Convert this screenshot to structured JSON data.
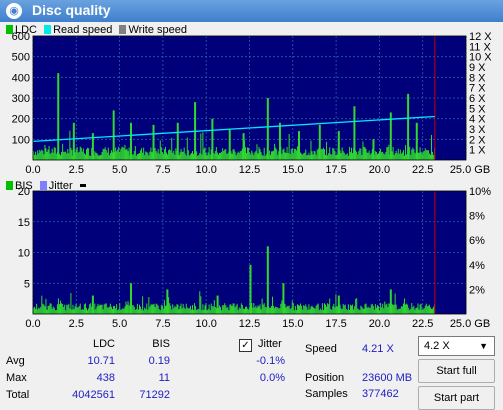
{
  "window": {
    "title": "Disc quality",
    "logo": "disc-logo-icon"
  },
  "top_legend": [
    {
      "label": "LDC",
      "color": "#00c000"
    },
    {
      "label": "Read speed",
      "color": "#00e8e8"
    },
    {
      "label": "Write speed",
      "color": "#808080"
    }
  ],
  "bottom_legend": [
    {
      "label": "BIS",
      "color": "#00c000"
    },
    {
      "label": "Jitter",
      "color": "#8080ff"
    }
  ],
  "colors": {
    "plot_bg": "#00007a",
    "grid": "#2a5fa8",
    "bar": "#30d830",
    "speed": "#00e8ff",
    "marker": "#c00000"
  },
  "chart_data": [
    {
      "type": "bar",
      "name": "LDC chart",
      "x_ticks": [
        "0.0",
        "2.5",
        "5.0",
        "7.5",
        "10.0",
        "12.5",
        "15.0",
        "17.5",
        "20.0",
        "22.5",
        "25.0 GB"
      ],
      "y_ticks_left": [
        "100",
        "200",
        "300",
        "400",
        "500",
        "600"
      ],
      "y_ticks_right": [
        "1 X",
        "2 X",
        "3 X",
        "4 X",
        "5 X",
        "6 X",
        "7 X",
        "8 X",
        "9 X",
        "10 X",
        "11 X",
        "12 X"
      ],
      "xlim": [
        0,
        25
      ],
      "ylim": [
        0,
        600
      ],
      "y2lim": [
        0,
        12
      ],
      "ldc_peaks": [
        [
          1.4,
          420
        ],
        [
          2.3,
          180
        ],
        [
          3.4,
          130
        ],
        [
          4.6,
          240
        ],
        [
          5.6,
          180
        ],
        [
          6.9,
          170
        ],
        [
          8.3,
          180
        ],
        [
          9.3,
          280
        ],
        [
          10.3,
          200
        ],
        [
          11.3,
          150
        ],
        [
          12.1,
          130
        ],
        [
          13.5,
          300
        ],
        [
          14.2,
          180
        ],
        [
          15.3,
          140
        ],
        [
          16.5,
          170
        ],
        [
          17.6,
          140
        ],
        [
          18.5,
          260
        ],
        [
          19.6,
          100
        ],
        [
          20.6,
          230
        ],
        [
          21.6,
          320
        ],
        [
          22.1,
          180
        ]
      ],
      "read_speed": {
        "x": [
          0,
          23.2
        ],
        "y": [
          1.8,
          4.21
        ]
      },
      "end_marker_x": 23.2
    },
    {
      "type": "bar",
      "name": "BIS chart",
      "x_ticks": [
        "0.0",
        "2.5",
        "5.0",
        "7.5",
        "10.0",
        "12.5",
        "15.0",
        "17.5",
        "20.0",
        "22.5",
        "25.0 GB"
      ],
      "y_ticks_left": [
        "5",
        "10",
        "15",
        "20"
      ],
      "y_ticks_right": [
        "2%",
        "4%",
        "6%",
        "8%",
        "10%"
      ],
      "xlim": [
        0,
        25
      ],
      "ylim": [
        0,
        20
      ],
      "y2lim": [
        0,
        10
      ],
      "bis_peaks": [
        [
          3.4,
          3
        ],
        [
          5.6,
          5
        ],
        [
          7.7,
          4
        ],
        [
          10.6,
          3
        ],
        [
          12.5,
          8
        ],
        [
          13.5,
          11
        ],
        [
          14.4,
          5
        ],
        [
          17.6,
          3
        ],
        [
          20.6,
          4
        ]
      ],
      "jitter_level_percent": 0,
      "end_marker_x": 23.2
    }
  ],
  "stats": {
    "col_ldc": "LDC",
    "col_bis": "BIS",
    "rows": [
      {
        "label": "Avg",
        "ldc": "10.71",
        "bis": "0.19",
        "jitter": "-0.1%"
      },
      {
        "label": "Max",
        "ldc": "438",
        "bis": "11",
        "jitter": "0.0%"
      },
      {
        "label": "Total",
        "ldc": "4042561",
        "bis": "71292",
        "jitter": ""
      }
    ],
    "jitter_label": "Jitter",
    "jitter_checked": "✓"
  },
  "info": {
    "speed_label": "Speed",
    "speed_value": "4.21 X",
    "position_label": "Position",
    "position_value": "23600 MB",
    "samples_label": "Samples",
    "samples_value": "377462"
  },
  "controls": {
    "speed_select": "4.2 X",
    "start_full": "Start full",
    "start_part": "Start part"
  }
}
